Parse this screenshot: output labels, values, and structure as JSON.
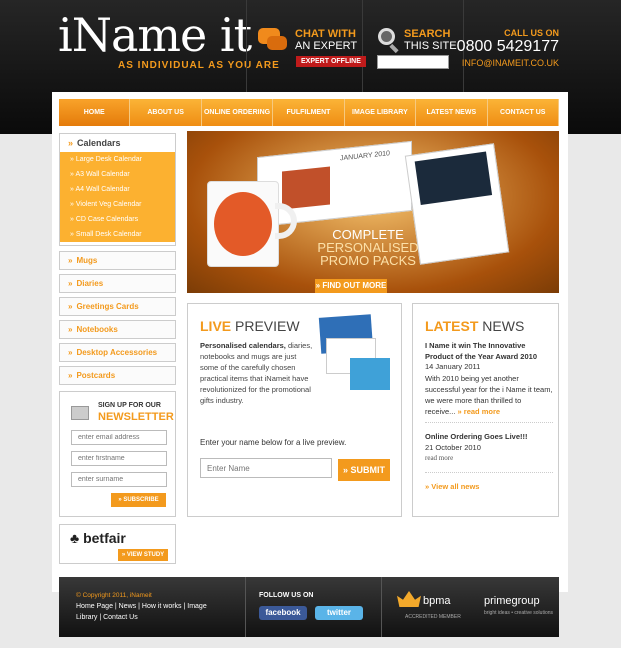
{
  "header": {
    "logo": "iName it",
    "tagline": "AS INDIVIDUAL AS YOU ARE",
    "chat_line1": "CHAT WITH",
    "chat_line2": "AN EXPERT",
    "expert_status": "EXPERT OFFLINE",
    "search_line1": "SEARCH",
    "search_line2": "THIS SITE",
    "search_value": "",
    "call_label": "CALL US ON",
    "phone": "0800 5429177",
    "email": "INFO@INAMEIT.CO.UK"
  },
  "nav": [
    "HOME",
    "ABOUT US",
    "ONLINE ORDERING",
    "FULFILMENT",
    "IMAGE LIBRARY",
    "LATEST NEWS",
    "CONTACT US"
  ],
  "sidebar": {
    "calendars": "Calendars",
    "sub": [
      "Large Desk Calendar",
      "A3 Wall Calendar",
      "A4 Wall Calendar",
      "Violent Veg Calendar",
      "CD Case Calendars",
      "Small Desk Calendar"
    ],
    "items": [
      "Mugs",
      "Diaries",
      "Greetings Cards",
      "Notebooks",
      "Desktop Accessories",
      "Postcards"
    ]
  },
  "newsletter": {
    "line1": "SIGN UP FOR OUR",
    "line2": "NEWSLETTER",
    "email_ph": "enter email address",
    "first_ph": "enter firstname",
    "sur_ph": "enter surname",
    "button": "» SUBSCRIBE"
  },
  "betfair": {
    "logo": "betfair",
    "button": "» VIEW STUDY"
  },
  "hero": {
    "month": "JANUARY 2010",
    "line1": "COMPLETE",
    "line2": "PERSONALISED",
    "line3": "PROMO PACKS",
    "button": "» FIND OUT MORE"
  },
  "preview": {
    "h_hl": "LIVE",
    "h_rest": "PREVIEW",
    "bold": "Personalised calendars,",
    "text": "diaries, notebooks and mugs are just some of the carefully chosen practical items that iNameit have revolutionized for the promotional gifts industry.",
    "enter": "Enter your name below for a live preview.",
    "placeholder": "Enter Name",
    "button": "» SUBMIT"
  },
  "news": {
    "h_hl": "LATEST",
    "h_rest": "NEWS",
    "n1_title": "I Name it win The Innovative Product of the Year Award 2010",
    "n1_date": "14 January 2011",
    "n1_body": "With 2010 being yet another successful year for the i Name it team, we were more than thrilled to receive... ",
    "n1_more": "» read more",
    "n2_title": "Online Ordering Goes Live!!!",
    "n2_date": "21 October 2010",
    "n2_more": "read more",
    "view_all": "» View all news"
  },
  "footer": {
    "copyright": "© Copyright 2011, iNameit",
    "links": "Home Page | News | How it works | Image Library | Contact Us",
    "follow": "FOLLOW US ON",
    "facebook": "facebook",
    "twitter": "twitter",
    "bpma": "bpma",
    "bpma_sub": "ACCREDITED MEMBER",
    "prime": "primegroup",
    "prime_sub": "bright ideas • creative solutions"
  },
  "colors": {
    "accent": "#f39a1d",
    "dark": "#111111"
  }
}
